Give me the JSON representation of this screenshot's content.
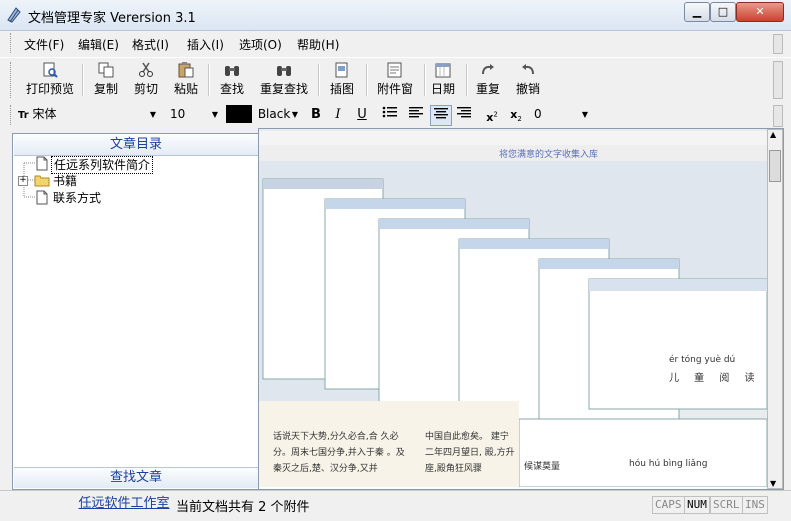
{
  "window": {
    "title": "文档管理专家 Verersion 3.1"
  },
  "window_controls": {
    "minimize": "▁",
    "maximize": "□",
    "close": "✕"
  },
  "menu": [
    {
      "label": "文件(F)"
    },
    {
      "label": "编辑(E)"
    },
    {
      "label": "格式(I)"
    },
    {
      "label": "插入(I)"
    },
    {
      "label": "选项(O)"
    },
    {
      "label": "帮助(H)"
    }
  ],
  "toolbar": [
    {
      "label": "打印预览",
      "icon": "print-preview-icon"
    },
    {
      "label": "复制",
      "icon": "copy-icon"
    },
    {
      "label": "剪切",
      "icon": "cut-icon"
    },
    {
      "label": "粘贴",
      "icon": "paste-icon"
    },
    {
      "label": "查找",
      "icon": "binoculars-icon"
    },
    {
      "label": "重复查找",
      "icon": "binoculars-icon"
    },
    {
      "label": "插图",
      "icon": "insert-picture-icon"
    },
    {
      "label": "附件窗",
      "icon": "attachment-icon"
    },
    {
      "label": "日期",
      "icon": "calendar-icon"
    },
    {
      "label": "重复",
      "icon": "redo-icon"
    },
    {
      "label": "撤销",
      "icon": "undo-icon"
    }
  ],
  "format": {
    "font_prefix": "Tr",
    "font": "宋体",
    "size": "10",
    "color_name": "Black",
    "color_hex": "#000000",
    "bold": "B",
    "italic": "I",
    "underline": "U",
    "spacing": "0"
  },
  "left_panel": {
    "header": "文章目录",
    "footer": "查找文章",
    "tree": [
      {
        "label": "任远系列软件简介",
        "type": "doc",
        "selected": true
      },
      {
        "label": "书籍",
        "type": "folder",
        "expander": "+"
      },
      {
        "label": "联系方式",
        "type": "doc"
      }
    ]
  },
  "document_panel": {
    "screenshot_top_text": "将您满意的文字收集入库",
    "para_left": "话说天下大势,分久必合,合 久必分。周末七国分争,并入于秦 。及秦灭之后,楚、汉分争,又并",
    "para_right": "中国自此愈矣。 建宁二年四月望日, 殿,方升座,殿角狂风骤",
    "pinyin_top": "ér tóng yuè dú",
    "hanzi_row": "儿 童 阅 读",
    "inner_field": "候谋莫量",
    "inner_pinyin": "hóu  hú  bìng  liǎng"
  },
  "status": {
    "link": "任远软件工作室",
    "text": "当前文档共有 2 个附件",
    "indicators": [
      {
        "label": "CAPS",
        "on": false
      },
      {
        "label": "NUM",
        "on": true
      },
      {
        "label": "SCRL",
        "on": false
      },
      {
        "label": "INS",
        "on": false
      }
    ]
  }
}
